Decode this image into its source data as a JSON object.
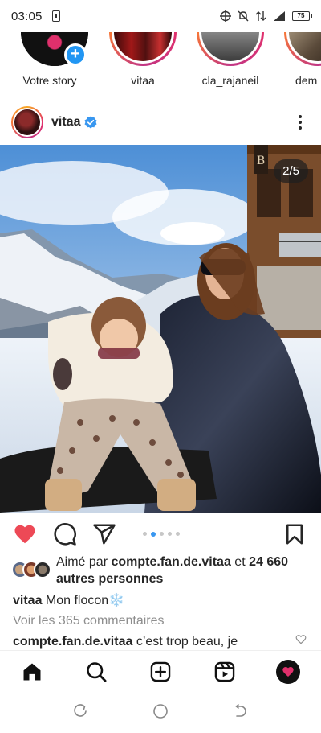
{
  "status_bar": {
    "time": "03:05",
    "battery": "75"
  },
  "stories": [
    {
      "label": "Votre story",
      "type": "own"
    },
    {
      "label": "vitaa",
      "type": "ring"
    },
    {
      "label": "cla_rajaneil",
      "type": "ring"
    },
    {
      "label": "dem",
      "type": "ring"
    }
  ],
  "post": {
    "username": "vitaa",
    "image_counter": "2/5",
    "liked_by_prefix": "Aimé par ",
    "liked_by_user": "compte.fan.de.vitaa",
    "liked_by_mid": " et ",
    "liked_by_count": "24 660 autres personnes",
    "caption_user": "vitaa",
    "caption_text": " Mon flocon❄️",
    "view_comments": "Voir les 365 commentaires",
    "comment_user": "compte.fan.de.vitaa",
    "comment_text": " c’est trop beau, je"
  },
  "carousel": {
    "total": 5,
    "active": 2
  },
  "colors": {
    "like_red": "#ed4956",
    "verified_blue": "#3897f0",
    "story_add_blue": "#2196f3"
  },
  "icons": {
    "actions": [
      "heart-icon",
      "comment-icon",
      "share-icon",
      "bookmark-icon"
    ],
    "tabs": [
      "home-icon",
      "search-icon",
      "new-post-icon",
      "reels-icon",
      "profile-icon"
    ],
    "system": [
      "recents-icon",
      "home-circle-icon",
      "back-icon"
    ]
  }
}
